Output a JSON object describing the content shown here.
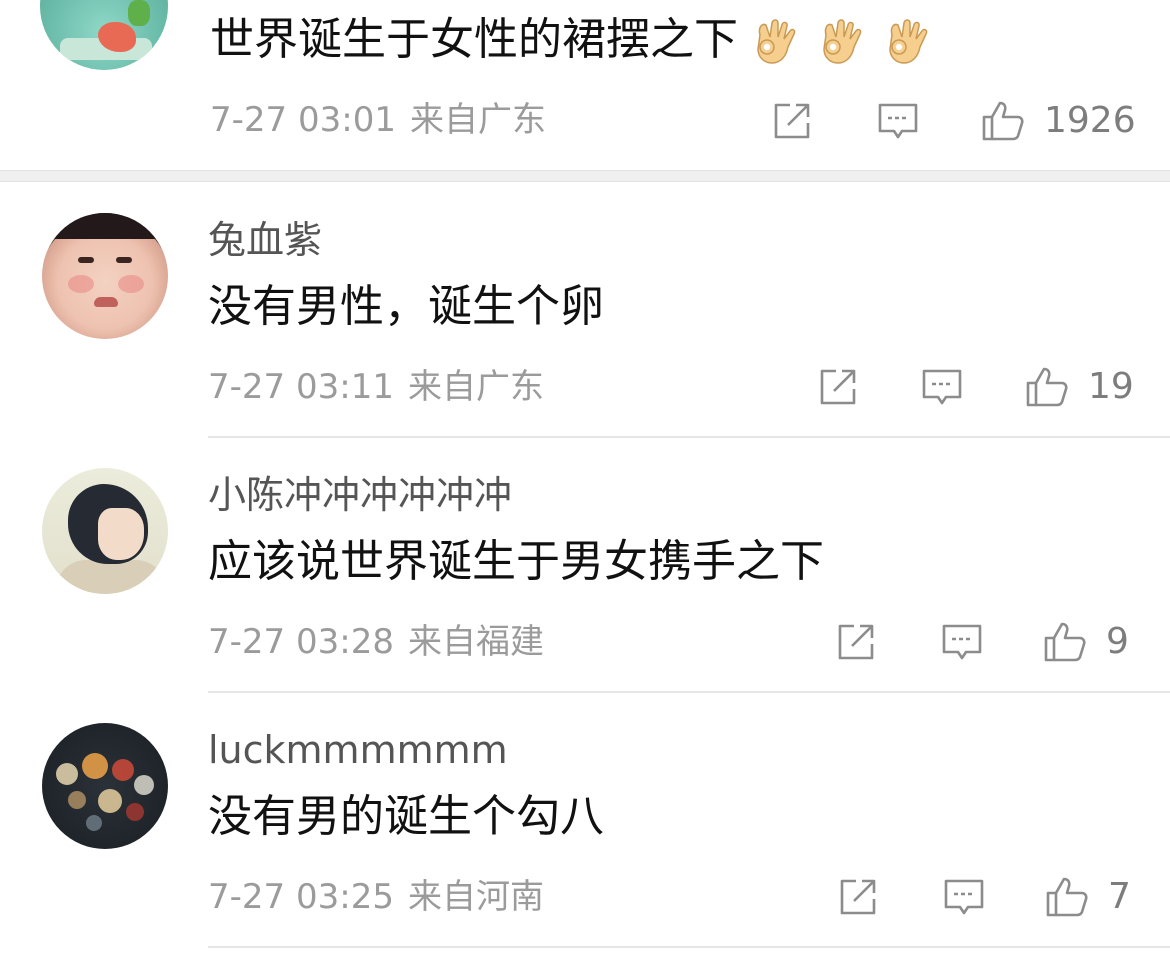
{
  "top_comment": {
    "text": "世界诞生于女性的裙摆之下",
    "emojis": [
      "👌",
      "👌",
      "👌"
    ],
    "date": "7-27 03:01",
    "location": "来自广东",
    "likes": "1926"
  },
  "replies": [
    {
      "username": "兔血紫",
      "content": "没有男性，诞生个卵",
      "date": "7-27 03:11",
      "location": "来自广东",
      "likes": "19"
    },
    {
      "username": "小陈冲冲冲冲冲冲",
      "content": "应该说世界诞生于男女携手之下",
      "date": "7-27 03:28",
      "location": "来自福建",
      "likes": "9"
    },
    {
      "username": "luckmmmmmm",
      "content": "没有男的诞生个勾八",
      "date": "7-27 03:25",
      "location": "来自河南",
      "likes": "7"
    }
  ],
  "icons": {
    "share": "share-icon",
    "comment": "comment-icon",
    "like": "thumbs-up-icon"
  },
  "colors": {
    "text_primary": "#111111",
    "text_meta": "#9b9b9b",
    "username": "#555555",
    "icon_gray": "#8c8c8c",
    "divider": "#e6e6e6"
  }
}
